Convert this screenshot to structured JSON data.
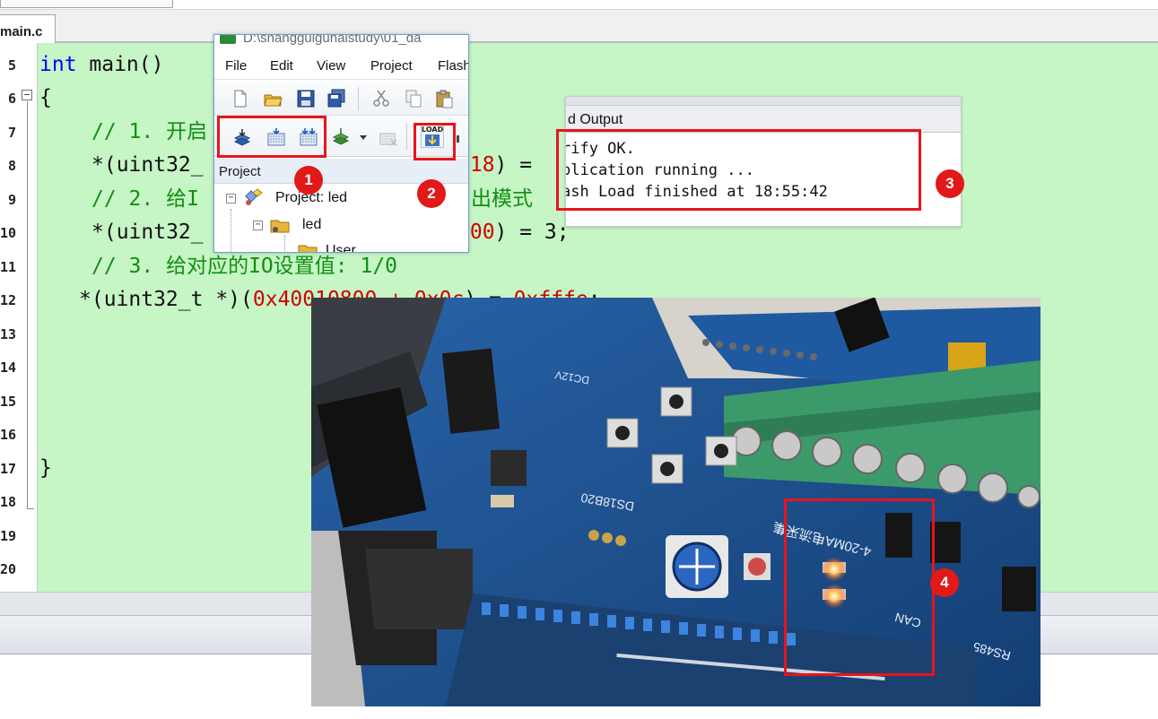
{
  "editor": {
    "tab_label": "main.c",
    "line_numbers": [
      "5",
      "6",
      "7",
      "8",
      "9",
      "10",
      "11",
      "12",
      "13",
      "14",
      "15",
      "16",
      "17",
      "18",
      "19",
      "20"
    ],
    "code": {
      "l5_kw": "int",
      "l5_rest": " main()",
      "l6": "{",
      "l7": "// 1. 开启",
      "l8_a": "*(uint32_",
      "l8_b": "x18",
      "l8_c": ") = ",
      "l9_a": "// 2. 给I",
      "l9_b": "出模式",
      "l10_a": "*(uint32_",
      "l10_b": "x00",
      "l10_c": ") = 3;",
      "l11": "// 3. 给对应的IO设置值: 1/0",
      "l12_a": "*(uint32_t *)(",
      "l12_b": "0x40010800 + 0x0c",
      "l12_c": ") = ",
      "l12_d": "0xfffe",
      "l12_e": ";",
      "l17": "}"
    }
  },
  "ide": {
    "title": "D:\\shangguiguhaistudy\\01_da",
    "menu": [
      "File",
      "Edit",
      "View",
      "Project",
      "Flash"
    ],
    "project_panel_title": "Project",
    "tree": {
      "project": "Project: led",
      "target": "led",
      "group": "User"
    },
    "load_label": "LOAD"
  },
  "build_output": {
    "title": "d Output",
    "lines": [
      "rify OK.",
      "plication running ...",
      "ash Load finished at 18:55:42"
    ]
  },
  "photo": {
    "board_labels": {
      "can": "CAN",
      "rs485": "RS485",
      "ds18b20": "DS18B20",
      "ma": "4-20MA电流采集",
      "dc12v": "DC12V"
    }
  },
  "annotations": [
    "1",
    "2",
    "3",
    "4"
  ],
  "colors": {
    "editor_bg": "#c6f5c6",
    "keyword": "#0000ff",
    "comment": "#109010",
    "hex": "#d00000",
    "annotation_red": "#e8141b",
    "pcb_blue": "#1d4b82"
  }
}
